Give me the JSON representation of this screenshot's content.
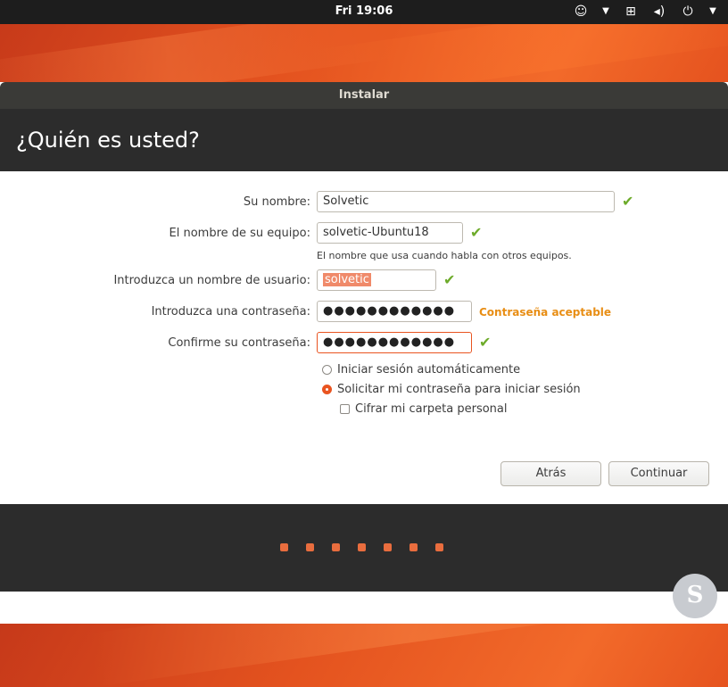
{
  "topbar": {
    "clock": "Fri 19:06",
    "icons": [
      "accessibility-icon",
      "chevron-down-icon",
      "network-icon",
      "volume-icon",
      "power-icon",
      "chevron-down-icon"
    ]
  },
  "window": {
    "title": "Instalar",
    "heading": "¿Quién es usted?"
  },
  "form": {
    "name_label": "Su nombre:",
    "name_value": "Solvetic",
    "computer_label": "El nombre de su equipo:",
    "computer_value": "solvetic-Ubuntu18",
    "computer_hint": "El nombre que usa cuando habla con otros equipos.",
    "username_label": "Introduzca un nombre de usuario:",
    "username_value": "solvetic",
    "password_label": "Introduzca una contraseña:",
    "password_value": "●●●●●●●●●●●●",
    "password_strength": "Contraseña aceptable",
    "confirm_label": "Confirme su contraseña:",
    "confirm_value": "●●●●●●●●●●●●",
    "options": {
      "auto_login": "Iniciar sesión automáticamente",
      "require_password": "Solicitar mi contraseña para iniciar sesión",
      "encrypt_home": "Cifrar mi carpeta personal"
    },
    "selected_option": "require_password",
    "encrypt_checked": false
  },
  "buttons": {
    "back": "Atrás",
    "continue": "Continuar"
  },
  "progress": {
    "steps": 7
  },
  "watermark": {
    "glyph": "S"
  },
  "colors": {
    "accent": "#e95420",
    "check": "#6dab2a",
    "strength": "#e88e15"
  }
}
